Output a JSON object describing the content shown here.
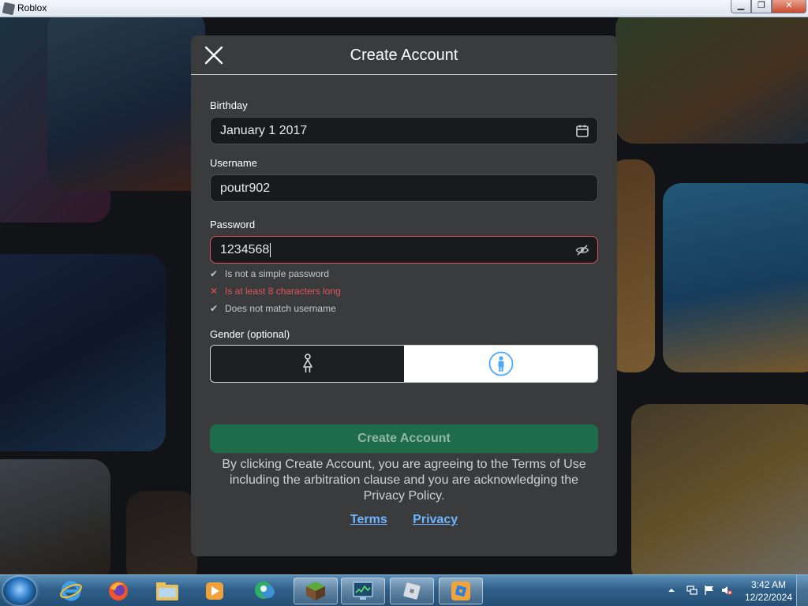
{
  "window": {
    "title": "Roblox",
    "minimize_glyph": "▁",
    "maximize_glyph": "❐",
    "close_glyph": "✕"
  },
  "modal": {
    "title": "Create Account",
    "birthday": {
      "label": "Birthday",
      "value": "January 1 2017",
      "icon": "calendar-icon"
    },
    "username": {
      "label": "Username",
      "value": "poutr902"
    },
    "password": {
      "label": "Password",
      "value": "1234568",
      "icon": "eye-slash-icon",
      "state": "error"
    },
    "password_rules": [
      {
        "mark": "✔",
        "text": "Is not a simple password",
        "status": "pass"
      },
      {
        "mark": "✕",
        "text": "Is at least 8 characters long",
        "status": "fail"
      },
      {
        "mark": "✔",
        "text": "Does not match username",
        "status": "pass"
      }
    ],
    "gender": {
      "label": "Gender (optional)",
      "options": [
        {
          "icon": "female-icon",
          "selected": false
        },
        {
          "icon": "male-icon",
          "selected": true
        }
      ]
    },
    "submit_label": "Create Account",
    "legal_text": "By clicking Create Account, you are agreeing to the Terms of Use including the arbitration clause and you are acknowledging the Privacy Policy.",
    "links": {
      "terms": "Terms",
      "privacy": "Privacy"
    }
  },
  "colors": {
    "accent_green": "#1f6c4b",
    "error_red": "#e0535a",
    "link_blue": "#6eb4ff",
    "modal_bg": "#393b3d"
  },
  "taskbar": {
    "apps": [
      {
        "name": "internet-explorer-icon"
      },
      {
        "name": "firefox-icon"
      },
      {
        "name": "file-explorer-icon"
      },
      {
        "name": "media-player-icon"
      },
      {
        "name": "messenger-icon"
      },
      {
        "name": "minecraft-icon"
      },
      {
        "name": "task-manager-icon"
      },
      {
        "name": "roblox-icon"
      },
      {
        "name": "roblox-studio-icon"
      }
    ],
    "clock": {
      "time": "3:42 AM",
      "date": "12/22/2024"
    }
  }
}
